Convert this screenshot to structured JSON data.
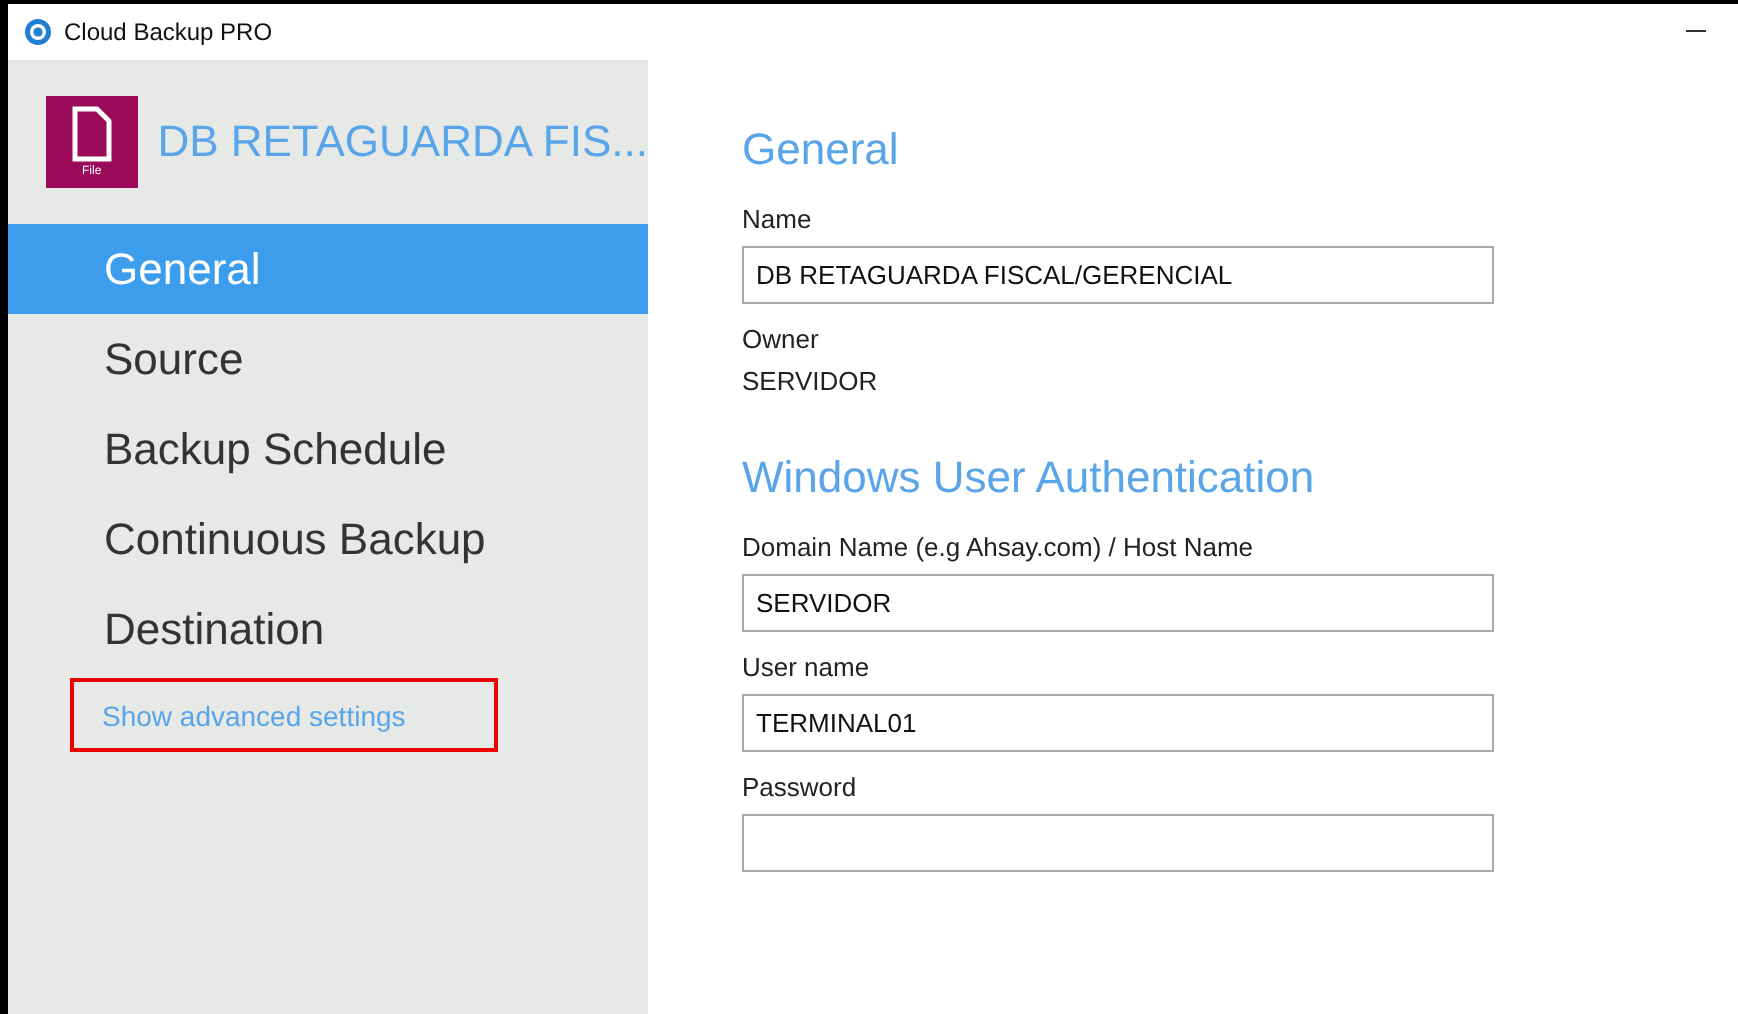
{
  "window": {
    "title": "Cloud Backup PRO"
  },
  "backup_set": {
    "name": "DB RETAGUARDA FIS...",
    "icon_label": "File"
  },
  "sidebar": {
    "items": [
      {
        "label": "General",
        "selected": true
      },
      {
        "label": "Source",
        "selected": false
      },
      {
        "label": "Backup Schedule",
        "selected": false
      },
      {
        "label": "Continuous Backup",
        "selected": false
      },
      {
        "label": "Destination",
        "selected": false
      }
    ],
    "link": {
      "label": "Show advanced settings",
      "highlighted": true
    }
  },
  "sections": [
    {
      "title": "General",
      "fields": [
        {
          "kind": "input",
          "label": "Name",
          "value": "DB RETAGUARDA FISCAL/GERENCIAL"
        },
        {
          "kind": "text",
          "label": "Owner",
          "value": "SERVIDOR"
        }
      ]
    },
    {
      "title": "Windows User Authentication",
      "fields": [
        {
          "kind": "input",
          "label": "Domain Name (e.g Ahsay.com) / Host Name",
          "value": "SERVIDOR"
        },
        {
          "kind": "input",
          "label": "User name",
          "value": "TERMINAL01"
        },
        {
          "kind": "input",
          "label": "Password"
        }
      ]
    }
  ]
}
